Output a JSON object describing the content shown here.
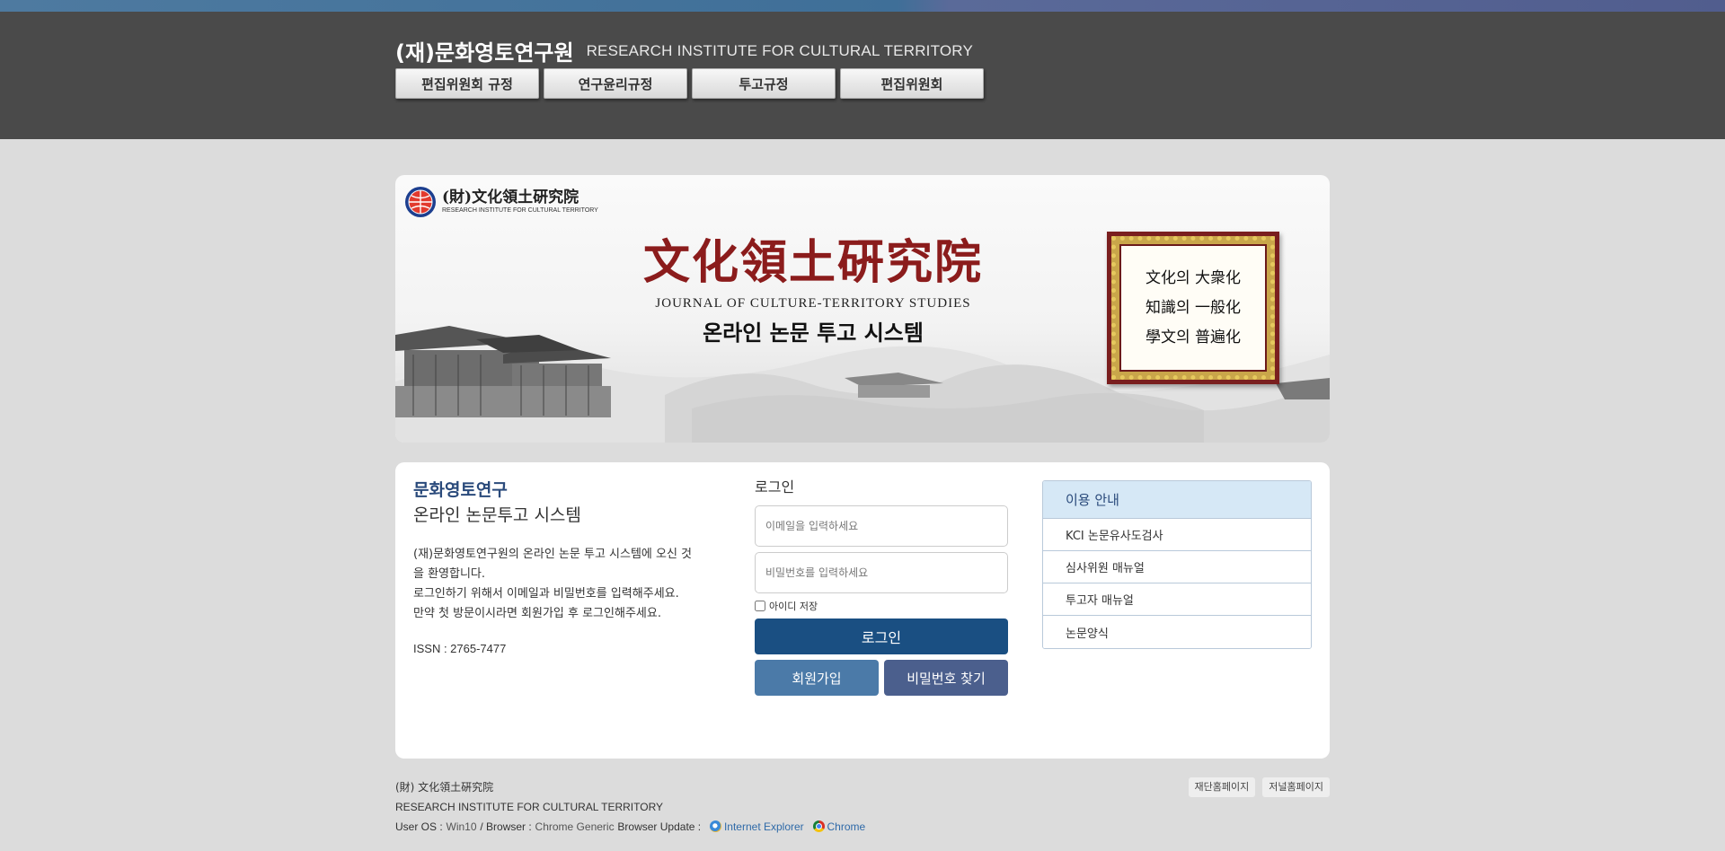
{
  "header": {
    "brand_ko": "(재)문화영토연구원",
    "brand_en": "RESEARCH INSTITUTE FOR CULTURAL TERRITORY",
    "nav": [
      "편집위원회 규정",
      "연구윤리규정",
      "투고규정",
      "편집위원회"
    ]
  },
  "banner": {
    "logo_cjk": "(財)文化領土硏究院",
    "logo_en": "RESEARCH INSTITUTE FOR CULTURAL TERRITORY",
    "title": "文化領土硏究院",
    "subtitle_en": "JOURNAL OF CULTURE-TERRITORY STUDIES",
    "subtitle_ko": "온라인 논문 투고 시스템",
    "frame_lines": [
      "文化의 大衆化",
      "知識의 一般化",
      "學文의 普遍化"
    ]
  },
  "intro": {
    "title": "문화영토연구",
    "subtitle": "온라인 논문투고 시스템",
    "desc_lines": [
      "(재)문화영토연구원의 온라인 논문 투고 시스템에 오신 것",
      "을 환영합니다.",
      "로그인하기 위해서 이메일과 비밀번호를 입력해주세요.",
      "만약 첫 방문이시라면 회원가입 후 로그인해주세요."
    ],
    "issn": "ISSN : 2765-7477"
  },
  "login": {
    "label": "로그인",
    "email_placeholder": "이메일을 입력하세요",
    "email_value": "",
    "password_placeholder": "비밀번호를 입력하세요",
    "password_value": "",
    "remember_label": "아이디 저장",
    "remember_checked": false,
    "login_button": "로그인",
    "join_button": "회원가입",
    "find_password_button": "비밀번호 찾기"
  },
  "guide": {
    "title": "이용 안내",
    "items": [
      "KCI 논문유사도검사",
      "심사위원 매뉴얼",
      "투고자 매뉴얼",
      "논문양식"
    ]
  },
  "footer": {
    "org_cjk": "(財) 文化領土硏究院",
    "org_en": "RESEARCH INSTITUTE FOR CULTURAL TERRITORY",
    "os_label": "User OS :",
    "os_value": "Win10",
    "browser_label": "/ Browser :",
    "browser_value": "Chrome Generic",
    "update_label": "Browser Update :",
    "ie_link": "Internet Explorer",
    "chrome_link": "Chrome",
    "links": [
      "재단홈페이지",
      "저널홈페이지"
    ]
  },
  "colors": {
    "header_bg": "#4a4a4a",
    "accent_blue": "#1a4f82",
    "join_btn": "#4b7aa8",
    "find_btn": "#4b5f8d",
    "banner_title_red": "#8b1c1c"
  },
  "icons": {
    "logo": "globe-emblem-icon",
    "ie": "internet-explorer-icon",
    "chrome": "chrome-icon"
  }
}
